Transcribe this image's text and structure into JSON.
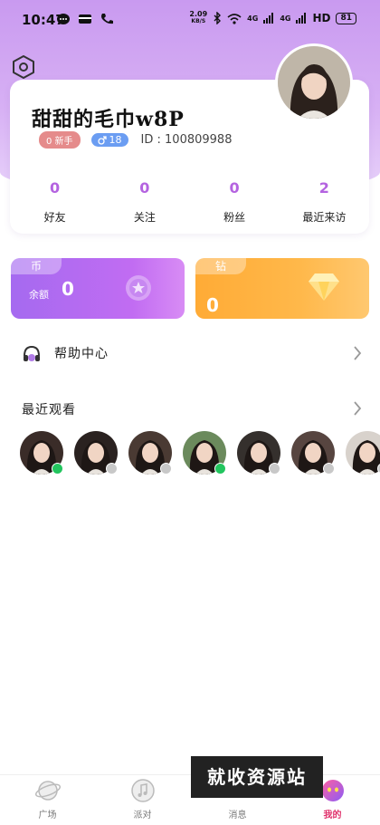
{
  "status_bar": {
    "time": "10:47",
    "speed_value": "2.09",
    "speed_unit": "KB/S",
    "signal1_label": "4G",
    "signal2_label": "4G",
    "hd_label": "HD",
    "battery": "81"
  },
  "profile": {
    "nickname": "甜甜的毛巾w8P",
    "newbie_badge": "0 新手",
    "gender_age": "18",
    "user_id": "ID : 100809988",
    "stats": [
      {
        "value": "0",
        "label": "好友"
      },
      {
        "value": "0",
        "label": "关注"
      },
      {
        "value": "0",
        "label": "粉丝"
      },
      {
        "value": "2",
        "label": "最近来访"
      }
    ]
  },
  "wallet": {
    "coin_tag": "币",
    "coin_label": "余额",
    "coin_value": "0",
    "diamond_tag": "钻",
    "diamond_value": "0"
  },
  "menu": {
    "help_label": "帮助中心"
  },
  "recent": {
    "title": "最近观看",
    "items": [
      {
        "online": true
      },
      {
        "online": false
      },
      {
        "online": false
      },
      {
        "online": true
      },
      {
        "online": false
      },
      {
        "online": false
      },
      {
        "online": false
      }
    ]
  },
  "nav": {
    "items": [
      {
        "label": "广场",
        "icon": "planet-icon",
        "active": false
      },
      {
        "label": "派对",
        "icon": "music-note-icon",
        "active": false
      },
      {
        "label": "消息",
        "icon": "message-icon",
        "active": false
      },
      {
        "label": "我的",
        "icon": "profile-face-icon",
        "active": true
      }
    ]
  },
  "watermark": "就收资源站",
  "colors": {
    "accent_purple": "#b463e0",
    "active_red": "#e0336d",
    "online_green": "#22c55e",
    "offline_gray": "#c8c8c8"
  }
}
